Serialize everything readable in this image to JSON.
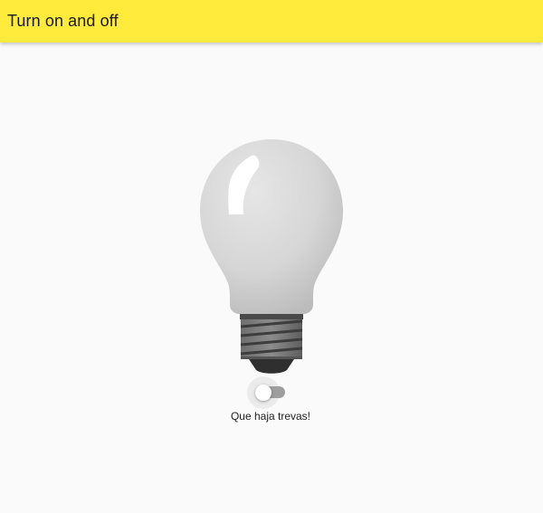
{
  "app_bar": {
    "title": "Turn on and off",
    "color": "#ffeb3b"
  },
  "lamp": {
    "icon": "lightbulb-icon",
    "state": "off"
  },
  "switch": {
    "icon": "toggle-switch",
    "checked": false
  },
  "status": {
    "text": "Que haja trevas!"
  }
}
